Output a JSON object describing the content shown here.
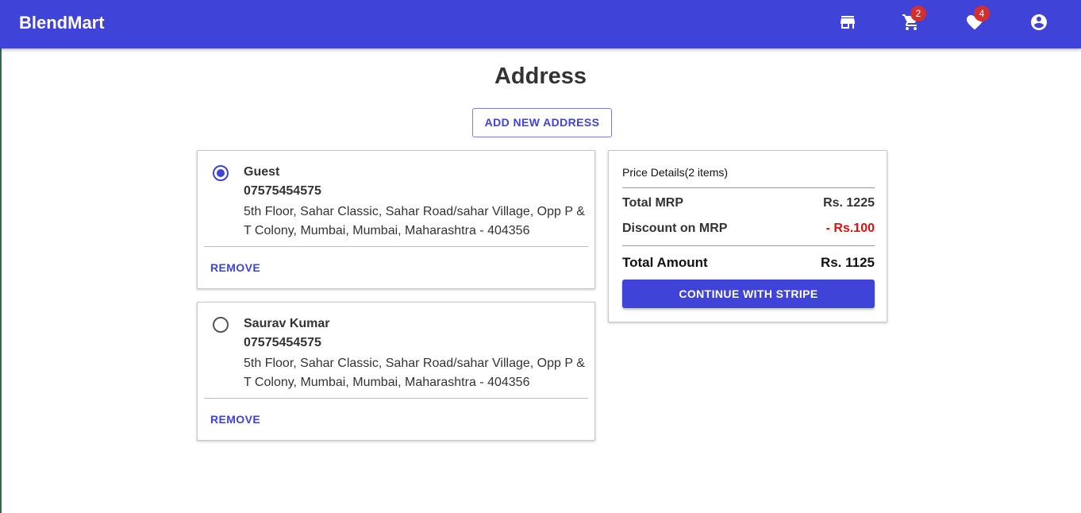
{
  "header": {
    "brand": "BlendMart",
    "icons": [
      {
        "name": "store-icon"
      },
      {
        "name": "cart-icon",
        "badge": "2"
      },
      {
        "name": "heart-icon",
        "badge": "4"
      },
      {
        "name": "account-circle-icon"
      }
    ]
  },
  "page": {
    "title": "Address",
    "add_button_label": "ADD NEW ADDRESS"
  },
  "addresses": [
    {
      "selected": true,
      "name": "Guest",
      "phone": "07575454575",
      "address": "5th Floor, Sahar Classic, Sahar Road/sahar Village, Opp P & T Colony, Mumbai, Mumbai, Maharashtra - 404356",
      "remove_label": "REMOVE"
    },
    {
      "selected": false,
      "name": "Saurav Kumar",
      "phone": "07575454575",
      "address": "5th Floor, Sahar Classic, Sahar Road/sahar Village, Opp P & T Colony, Mumbai, Mumbai, Maharashtra - 404356",
      "remove_label": "REMOVE"
    }
  ],
  "price_details": {
    "header": "Price Details(2 items)",
    "total_mrp_label": "Total MRP",
    "total_mrp_value": "Rs. 1225",
    "discount_label": "Discount on MRP",
    "discount_value": "- Rs.100",
    "total_amount_label": "Total Amount",
    "total_amount_value": "Rs. 1125",
    "checkout_label": "CONTINUE WITH STRIPE"
  },
  "colors": {
    "primary": "#3f43d8",
    "discount": "#e01010",
    "badge": "#d32f2f"
  }
}
